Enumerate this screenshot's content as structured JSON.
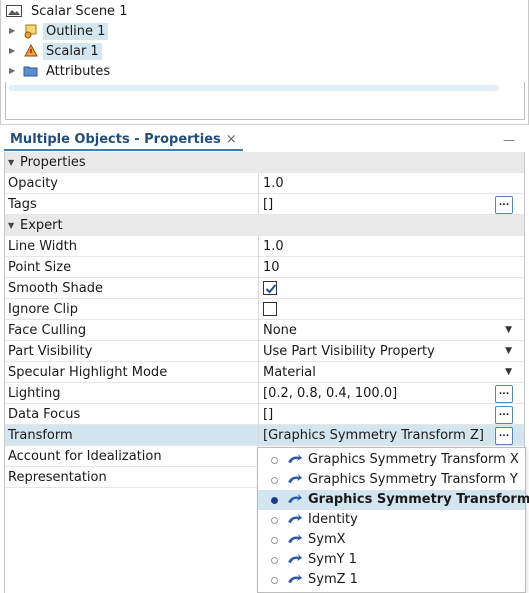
{
  "tree": {
    "items": [
      {
        "label": "Scalar Scene 1",
        "icon": "scene-icon",
        "selected": false
      },
      {
        "label": "Outline 1",
        "icon": "outline-displayer-icon",
        "selected": true
      },
      {
        "label": "Scalar 1",
        "icon": "scalar-displayer-icon",
        "selected": true
      },
      {
        "label": "Attributes",
        "icon": "folder-icon",
        "selected": false
      }
    ]
  },
  "properties_view": {
    "tab_title": "Multiple Objects - Properties",
    "close_glyph": "×",
    "minimize_glyph": "—"
  },
  "table": {
    "cat_properties": "Properties",
    "cat_expert": "Expert",
    "rows": {
      "opacity": {
        "name": "Opacity",
        "value": "1.0"
      },
      "tags": {
        "name": "Tags",
        "value": "[]"
      },
      "line_width": {
        "name": "Line Width",
        "value": "1.0"
      },
      "point_size": {
        "name": "Point Size",
        "value": "10"
      },
      "smooth_shade": {
        "name": "Smooth Shade",
        "checked": true
      },
      "ignore_clip": {
        "name": "Ignore Clip",
        "checked": false
      },
      "face_culling": {
        "name": "Face Culling",
        "value": "None"
      },
      "part_visibility": {
        "name": "Part Visibility",
        "value": "Use Part Visibility Property"
      },
      "specular": {
        "name": "Specular Highlight Mode",
        "value": "Material"
      },
      "lighting": {
        "name": "Lighting",
        "value": "[0.2, 0.8, 0.4, 100.0]"
      },
      "data_focus": {
        "name": "Data Focus",
        "value": "[]"
      },
      "transform": {
        "name": "Transform",
        "value": "[Graphics Symmetry Transform Z]"
      },
      "idealization": {
        "name": "Account for Idealization",
        "value": ""
      },
      "representation": {
        "name": "Representation",
        "value": ""
      }
    },
    "ellipsis": "..."
  },
  "transform_popup": {
    "options": [
      {
        "label": "Graphics Symmetry Transform X",
        "selected": false
      },
      {
        "label": "Graphics Symmetry Transform Y",
        "selected": false
      },
      {
        "label": "Graphics Symmetry Transform Z",
        "selected": true
      },
      {
        "label": "Identity",
        "selected": false
      },
      {
        "label": "SymX",
        "selected": false
      },
      {
        "label": "SymY 1",
        "selected": false
      },
      {
        "label": "SymZ 1",
        "selected": false
      }
    ]
  },
  "colors": {
    "selection": "#d3e5ef",
    "category_bg": "#e9e9e9",
    "tab_text": "#234e7a",
    "accent": "#3c7fb1"
  }
}
